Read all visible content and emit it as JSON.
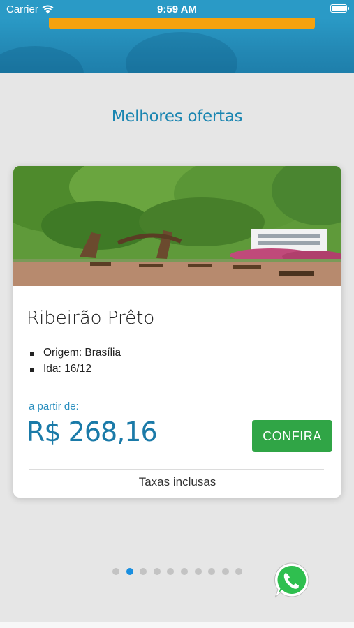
{
  "status_bar": {
    "carrier": "Carrier",
    "time": "9:59 AM"
  },
  "section": {
    "title": "Melhores ofertas"
  },
  "offer": {
    "city": "Ribeirão Prêto",
    "details": [
      "Origem: Brasília",
      "Ida: 16/12"
    ],
    "from_label": "a partir de:",
    "price": "R$ 268,16",
    "cta_label": "CONFIRA",
    "taxes_note": "Taxas inclusas"
  },
  "pagination": {
    "total": 10,
    "active_index": 1
  },
  "colors": {
    "header": "#2a9ac6",
    "cta_orange": "#f5a20f",
    "accent_blue": "#1a85b1",
    "confirm_green": "#30a546",
    "active_dot": "#1a8fe0"
  },
  "icons": [
    "wifi-icon",
    "battery-icon",
    "whatsapp-icon"
  ]
}
